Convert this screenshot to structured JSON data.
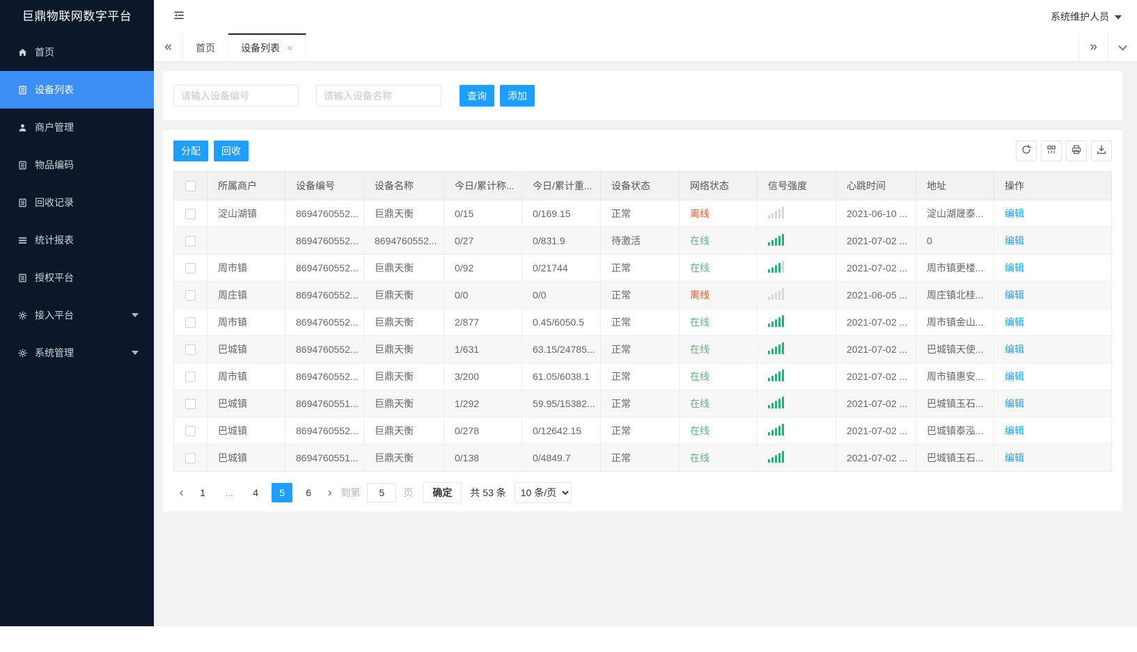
{
  "app": {
    "title": "巨鼎物联网数字平台",
    "user": "系统维护人员"
  },
  "sidebar": {
    "items": [
      {
        "label": "首页",
        "icon": "home",
        "active": false,
        "submenu": false
      },
      {
        "label": "设备列表",
        "icon": "clipboard",
        "active": true,
        "submenu": false
      },
      {
        "label": "商户管理",
        "icon": "user",
        "active": false,
        "submenu": false
      },
      {
        "label": "物品编码",
        "icon": "clipboard",
        "active": false,
        "submenu": false
      },
      {
        "label": "回收记录",
        "icon": "clipboard",
        "active": false,
        "submenu": false
      },
      {
        "label": "统计报表",
        "icon": "list",
        "active": false,
        "submenu": false
      },
      {
        "label": "授权平台",
        "icon": "clipboard",
        "active": false,
        "submenu": false
      },
      {
        "label": "接入平台",
        "icon": "gear",
        "active": false,
        "submenu": true
      },
      {
        "label": "系统管理",
        "icon": "gear",
        "active": false,
        "submenu": true
      }
    ]
  },
  "tabs": {
    "scroll_left": "«",
    "scroll_right": "»",
    "items": [
      {
        "label": "首页",
        "active": false,
        "closable": false
      },
      {
        "label": "设备列表",
        "active": true,
        "closable": true
      }
    ]
  },
  "search": {
    "device_no_placeholder": "请输入设备编号",
    "device_name_placeholder": "请输入设备名称",
    "query_label": "查询",
    "add_label": "添加"
  },
  "toolbar": {
    "assign_label": "分配",
    "recycle_label": "回收"
  },
  "table": {
    "action_label": "编辑",
    "columns": [
      "所属商户",
      "设备编号",
      "设备名称",
      "今日/累计称...",
      "今日/累计重...",
      "设备状态",
      "网络状态",
      "信号强度",
      "心跳时间",
      "地址",
      "操作"
    ],
    "rows": [
      {
        "merchant": "淀山湖镇",
        "device_no": "8694760552...",
        "device_name": "巨鼎天衡",
        "today_count": "0/15",
        "today_weight": "0/169.15",
        "device_status": "正常",
        "network_status": "离线",
        "network_online": false,
        "signal_green": 0,
        "heartbeat": "2021-06-10 ...",
        "address": "淀山湖晟泰..."
      },
      {
        "merchant": "",
        "device_no": "8694760552...",
        "device_name": "8694760552...",
        "today_count": "0/27",
        "today_weight": "0/831.9",
        "device_status": "待激活",
        "network_status": "在线",
        "network_online": true,
        "signal_green": 5,
        "heartbeat": "2021-07-02 ...",
        "address": "0"
      },
      {
        "merchant": "周市镇",
        "device_no": "8694760552...",
        "device_name": "巨鼎天衡",
        "today_count": "0/92",
        "today_weight": "0/21744",
        "device_status": "正常",
        "network_status": "在线",
        "network_online": true,
        "signal_green": 4,
        "heartbeat": "2021-07-02 ...",
        "address": "周市镇更楼..."
      },
      {
        "merchant": "周庄镇",
        "device_no": "8694760552...",
        "device_name": "巨鼎天衡",
        "today_count": "0/0",
        "today_weight": "0/0",
        "device_status": "正常",
        "network_status": "离线",
        "network_online": false,
        "signal_green": 0,
        "heartbeat": "2021-06-05 ...",
        "address": "周庄镇北桂..."
      },
      {
        "merchant": "周市镇",
        "device_no": "8694760552...",
        "device_name": "巨鼎天衡",
        "today_count": "2/877",
        "today_weight": "0.45/6050.5",
        "device_status": "正常",
        "network_status": "在线",
        "network_online": true,
        "signal_green": 5,
        "heartbeat": "2021-07-02 ...",
        "address": "周市镇金山..."
      },
      {
        "merchant": "巴城镇",
        "device_no": "8694760552...",
        "device_name": "巨鼎天衡",
        "today_count": "1/631",
        "today_weight": "63.15/24785...",
        "device_status": "正常",
        "network_status": "在线",
        "network_online": true,
        "signal_green": 5,
        "heartbeat": "2021-07-02 ...",
        "address": "巴城镇天使..."
      },
      {
        "merchant": "周市镇",
        "device_no": "8694760552...",
        "device_name": "巨鼎天衡",
        "today_count": "3/200",
        "today_weight": "61.05/6038.1",
        "device_status": "正常",
        "network_status": "在线",
        "network_online": true,
        "signal_green": 5,
        "heartbeat": "2021-07-02 ...",
        "address": "周市镇惠安..."
      },
      {
        "merchant": "巴城镇",
        "device_no": "8694760551...",
        "device_name": "巨鼎天衡",
        "today_count": "1/292",
        "today_weight": "59.95/15382...",
        "device_status": "正常",
        "network_status": "在线",
        "network_online": true,
        "signal_green": 5,
        "heartbeat": "2021-07-02 ...",
        "address": "巴城镇玉石..."
      },
      {
        "merchant": "巴城镇",
        "device_no": "8694760552...",
        "device_name": "巨鼎天衡",
        "today_count": "0/278",
        "today_weight": "0/12642.15",
        "device_status": "正常",
        "network_status": "在线",
        "network_online": true,
        "signal_green": 5,
        "heartbeat": "2021-07-02 ...",
        "address": "巴城镇泰泓..."
      },
      {
        "merchant": "巴城镇",
        "device_no": "8694760551...",
        "device_name": "巨鼎天衡",
        "today_count": "0/138",
        "today_weight": "0/4849.7",
        "device_status": "正常",
        "network_status": "在线",
        "network_online": true,
        "signal_green": 5,
        "heartbeat": "2021-07-02 ...",
        "address": "巴城镇玉石..."
      }
    ]
  },
  "pagination": {
    "pages": [
      {
        "label": "1",
        "active": false,
        "ellipsis": false
      },
      {
        "label": "...",
        "active": false,
        "ellipsis": true
      },
      {
        "label": "4",
        "active": false,
        "ellipsis": false
      },
      {
        "label": "5",
        "active": true,
        "ellipsis": false
      },
      {
        "label": "6",
        "active": false,
        "ellipsis": false
      }
    ],
    "prev_glyph": "‹",
    "next_glyph": "›",
    "goto_label": "到第",
    "goto_value": "5",
    "unit_label": "页",
    "confirm_label": "确定",
    "total_text": "共 53 条",
    "page_size_option": "10 条/页"
  },
  "colors": {
    "accent_blue": "#1e9fff",
    "sidebar_active_blue": "#3e8ef7",
    "online_green": "#5fb878",
    "signal_green": "#16b777",
    "offline_red": "#ff5722",
    "sidebar_bg": "#0c1829"
  }
}
